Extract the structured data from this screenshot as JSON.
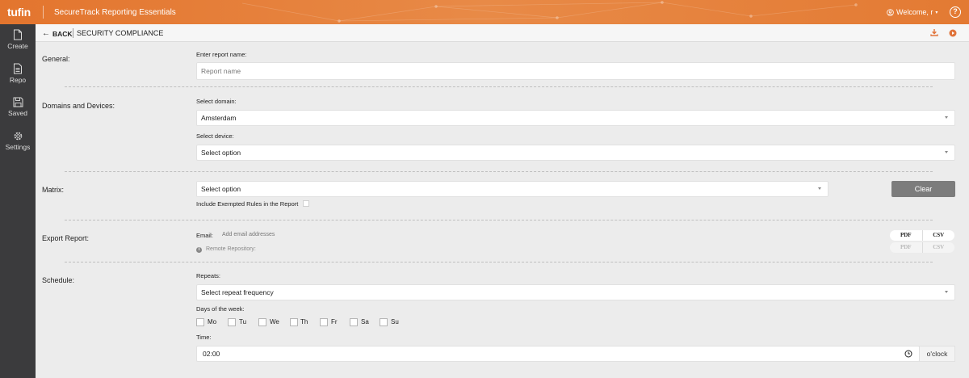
{
  "header": {
    "logo": "tufin",
    "app_title": "SecureTrack Reporting Essentials",
    "welcome": "Welcome, r",
    "help": "?"
  },
  "sidebar": {
    "items": [
      {
        "label": "Create",
        "icon": "file-icon"
      },
      {
        "label": "Repo",
        "icon": "document-icon"
      },
      {
        "label": "Saved",
        "icon": "floppy-icon"
      },
      {
        "label": "Settings",
        "icon": "gear-icon"
      }
    ]
  },
  "subheader": {
    "back": "BACK",
    "title": "SECURITY COMPLIANCE"
  },
  "general": {
    "label": "General:",
    "report_name_label": "Enter report name:",
    "report_name_placeholder": "Report name"
  },
  "domains": {
    "label": "Domains and Devices:",
    "domain_label": "Select domain:",
    "domain_value": "Amsterdam",
    "device_label": "Select device:",
    "device_value": "Select option"
  },
  "matrix": {
    "label": "Matrix:",
    "value": "Select option",
    "clear": "Clear",
    "include_exempted": "Include Exempted Rules in the Report"
  },
  "export": {
    "label": "Export Report:",
    "email_label": "Email:",
    "email_placeholder": "Add email addresses",
    "remote_repo": "Remote Repository:",
    "formats": [
      "PDF",
      "CSV"
    ]
  },
  "schedule": {
    "label": "Schedule:",
    "repeats_label": "Repeats:",
    "repeats_value": "Select repeat frequency",
    "days_label": "Days of the week:",
    "days": [
      "Mo",
      "Tu",
      "We",
      "Th",
      "Fr",
      "Sa",
      "Su"
    ],
    "time_label": "Time:",
    "time_value": "02:00",
    "time_suffix": "o'clock"
  },
  "colors": {
    "header": "#e07a36",
    "sidebar": "#3b3b3d",
    "accent": "#e0733a",
    "clear_button": "#7c7c7c"
  }
}
